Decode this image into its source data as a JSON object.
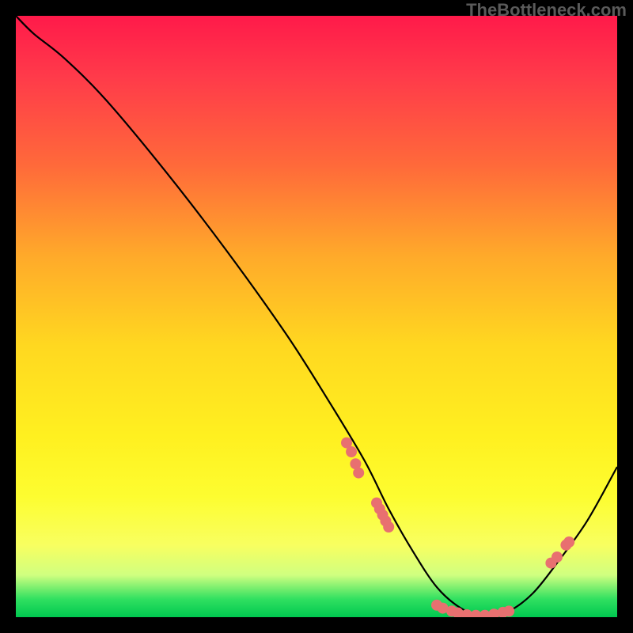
{
  "watermark": "TheBottleneck.com",
  "chart_data": {
    "type": "line",
    "title": "",
    "xlabel": "",
    "ylabel": "",
    "xlim": [
      0,
      100
    ],
    "ylim": [
      0,
      100
    ],
    "series": [
      {
        "name": "curve",
        "x": [
          0,
          3,
          8,
          15,
          25,
          35,
          45,
          52,
          58,
          62,
          66,
          70,
          74,
          78,
          82,
          86,
          90,
          95,
          100
        ],
        "values": [
          100,
          97,
          93,
          86,
          74,
          61,
          47,
          36,
          26,
          18,
          11,
          5,
          1.5,
          0,
          1,
          4,
          9,
          16,
          25
        ]
      }
    ],
    "points": [
      {
        "x": 55,
        "y": 29
      },
      {
        "x": 55.8,
        "y": 27.5
      },
      {
        "x": 56.5,
        "y": 25.5
      },
      {
        "x": 57,
        "y": 24
      },
      {
        "x": 60,
        "y": 19
      },
      {
        "x": 60.5,
        "y": 18
      },
      {
        "x": 61,
        "y": 17
      },
      {
        "x": 61.5,
        "y": 16
      },
      {
        "x": 62,
        "y": 15
      },
      {
        "x": 70,
        "y": 2
      },
      {
        "x": 71,
        "y": 1.5
      },
      {
        "x": 72.5,
        "y": 1
      },
      {
        "x": 73.5,
        "y": 0.7
      },
      {
        "x": 75,
        "y": 0.4
      },
      {
        "x": 76.5,
        "y": 0.3
      },
      {
        "x": 78,
        "y": 0.3
      },
      {
        "x": 79.5,
        "y": 0.5
      },
      {
        "x": 81,
        "y": 0.8
      },
      {
        "x": 82,
        "y": 1
      },
      {
        "x": 89,
        "y": 9
      },
      {
        "x": 90,
        "y": 10
      },
      {
        "x": 91.5,
        "y": 12
      },
      {
        "x": 92,
        "y": 12.5
      }
    ],
    "colors": {
      "curve": "#000000",
      "dots": "#e87070",
      "gradient_top": "#ff1a4a",
      "gradient_bottom": "#00c850"
    }
  }
}
